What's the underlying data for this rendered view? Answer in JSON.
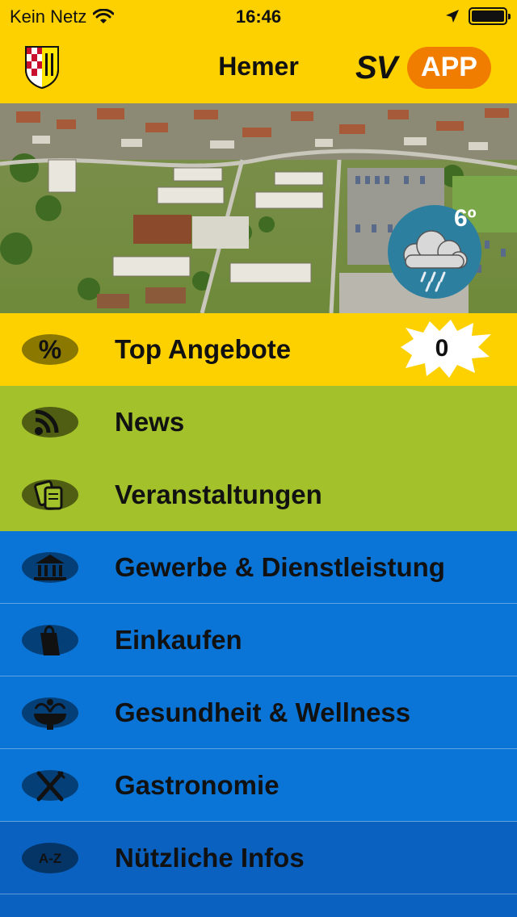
{
  "statusbar": {
    "carrier": "Kein Netz",
    "time": "16:46"
  },
  "navbar": {
    "title": "Hemer",
    "logo_sv": "SV",
    "logo_app": "APP"
  },
  "weather": {
    "temperature": "6º",
    "condition_icon": "rain-cloud-icon"
  },
  "menu": {
    "items": [
      {
        "label": "Top Angebote",
        "icon": "percent-icon",
        "color": "#fdd000",
        "badge": "0"
      },
      {
        "label": "News",
        "icon": "rss-icon",
        "color": "#a3c12a"
      },
      {
        "label": "Veranstaltungen",
        "icon": "tickets-icon",
        "color": "#a3c12a"
      },
      {
        "label": "Gewerbe & Dienstleistung",
        "icon": "bank-icon",
        "color": "#0a75d6"
      },
      {
        "label": "Einkaufen",
        "icon": "shopping-bag-icon",
        "color": "#0a75d6"
      },
      {
        "label": "Gesundheit & Wellness",
        "icon": "fountain-icon",
        "color": "#0a75d6"
      },
      {
        "label": "Gastronomie",
        "icon": "fork-knife-icon",
        "color": "#0a75d6"
      },
      {
        "label": "Nützliche Infos",
        "icon": "a-z-icon",
        "icon_text": "A-Z",
        "color": "#0a61c0"
      }
    ]
  }
}
